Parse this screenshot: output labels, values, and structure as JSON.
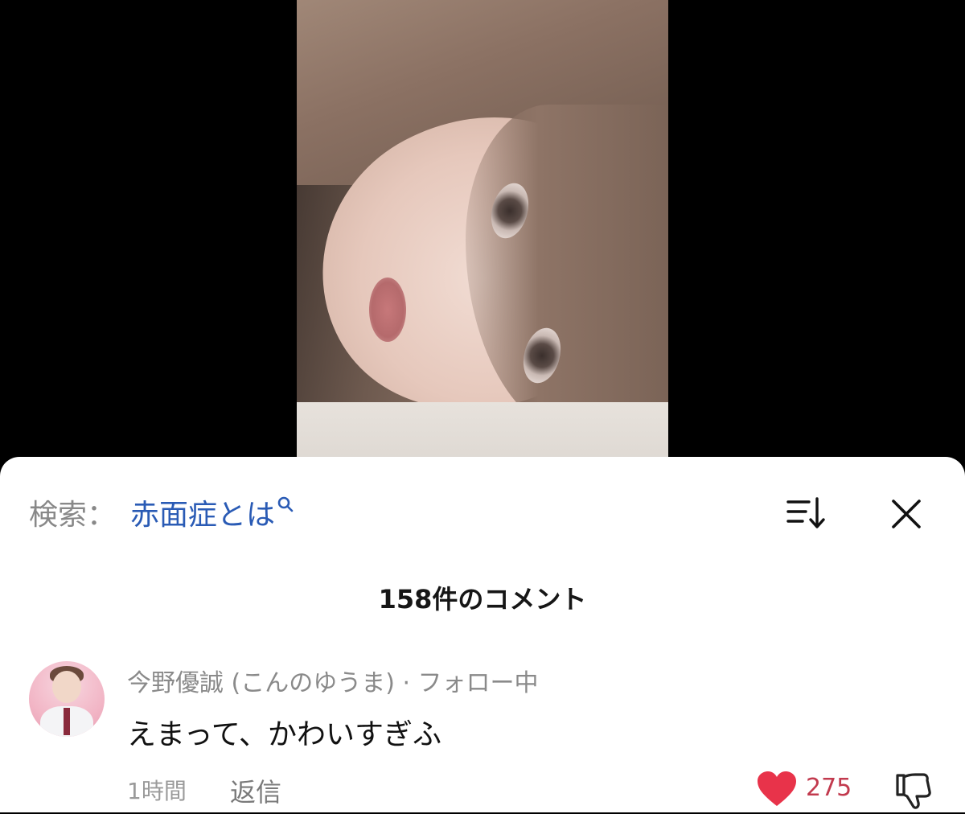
{
  "search": {
    "label": "検索：",
    "query": "赤面症とは"
  },
  "comments_header": {
    "count_label": "158件のコメント"
  },
  "comment": {
    "author": "今野優誠 (こんのゆうま) · フォロー中",
    "text": "えまって、かわいすぎふ",
    "time": "1時間",
    "reply_label": "返信",
    "likes": "275"
  },
  "colors": {
    "search_link": "#2a5bb5",
    "like_heart": "#e8334a",
    "like_count": "#c23a4e"
  },
  "icons": [
    "search-icon",
    "sort-icon",
    "close-icon",
    "heart-icon",
    "thumbs-down-icon"
  ]
}
